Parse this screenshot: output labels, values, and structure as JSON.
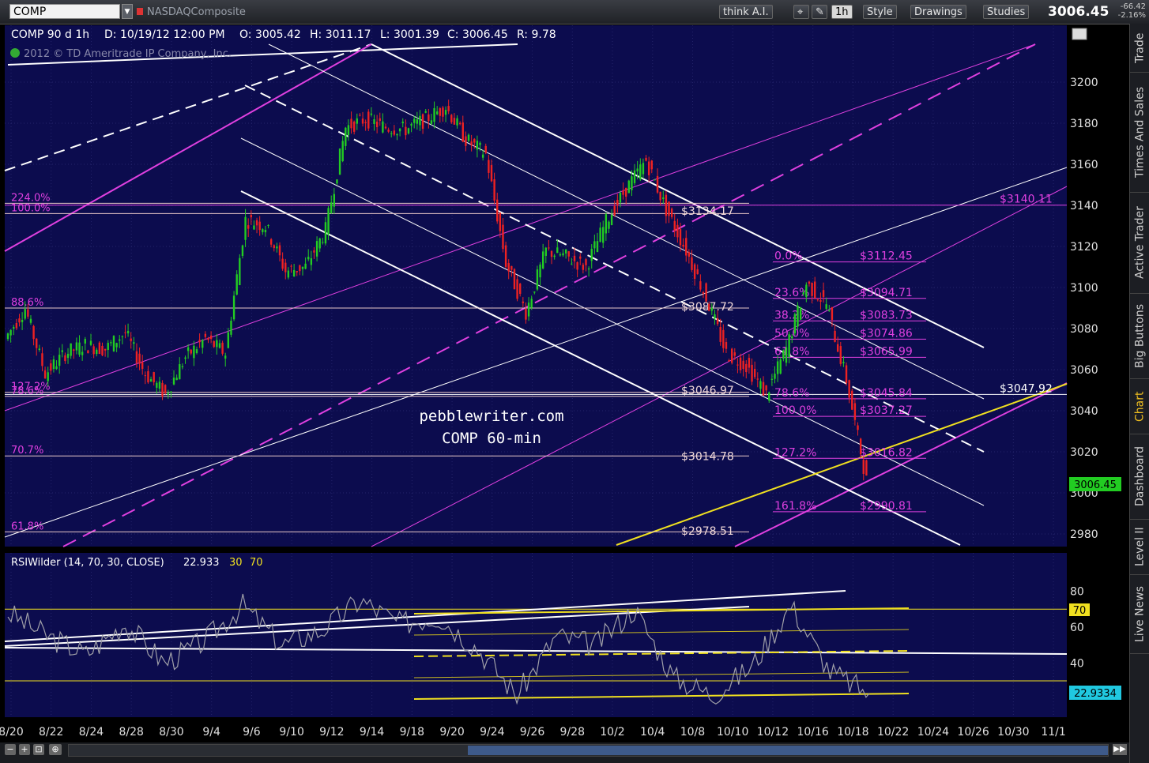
{
  "toolbar": {
    "symbol": "COMP",
    "symbol_name": "NASDAQComposite",
    "buttons": [
      "think A.I.",
      "1h",
      "Style",
      "Drawings",
      "Studies"
    ],
    "last": "3006.45",
    "change": "-66.42",
    "change_pct": "-2.16%"
  },
  "sidebar_tabs": [
    "Trade",
    "Times And Sales",
    "Active Trader",
    "Big Buttons",
    "Chart",
    "Dashboard",
    "Level II",
    "Live News"
  ],
  "header": {
    "period": "COMP 90 d 1h",
    "date": "D: 10/19/12 12:00 PM",
    "open": "O: 3005.42",
    "high": "H: 3011.17",
    "low": "L: 3001.39",
    "close": "C: 3006.45",
    "range": "R: 9.78",
    "copyright": "2012 © TD Ameritrade IP Company, Inc."
  },
  "watermark": {
    "line1": "pebblewriter.com",
    "line2": "COMP 60-min"
  },
  "colors": {
    "bg": "#0c0c4e",
    "magenta": "#e040e0",
    "white": "#ffffff",
    "yellow": "#f0e020",
    "up": "#22cc22",
    "down": "#ee2222",
    "rsi": "#a0a0a8"
  },
  "chart_data": [
    {
      "type": "line",
      "title": "",
      "xlabel": "",
      "ylabel": "",
      "y_ticks": [
        2980,
        3000,
        3020,
        3040,
        3060,
        3080,
        3100,
        3120,
        3140,
        3160,
        3180,
        3200
      ],
      "x_ticks": [
        "8/20",
        "8/22",
        "8/24",
        "8/28",
        "8/30",
        "9/4",
        "9/6",
        "9/10",
        "9/12",
        "9/14",
        "9/18",
        "9/20",
        "9/24",
        "9/26",
        "9/28",
        "10/2",
        "10/4",
        "10/8",
        "10/10",
        "10/12",
        "10/16",
        "10/18",
        "10/22",
        "10/24",
        "10/26",
        "10/30",
        "11/1"
      ],
      "ylim": [
        2976,
        3222
      ],
      "last_price_label": "3006.45",
      "series": [
        {
          "x": [
            "8/20",
            "8/21",
            "8/22",
            "8/23",
            "8/24",
            "8/27",
            "8/28",
            "8/29",
            "8/30",
            "8/31",
            "9/4",
            "9/5",
            "9/6",
            "9/7",
            "9/10",
            "9/11",
            "9/12",
            "9/13",
            "9/14",
            "9/17",
            "9/18",
            "9/19",
            "9/20",
            "9/21",
            "9/24",
            "9/25",
            "9/26",
            "9/27",
            "9/28",
            "10/1",
            "10/2",
            "10/3",
            "10/4",
            "10/5",
            "10/8",
            "10/9",
            "10/10",
            "10/11",
            "10/12",
            "10/15",
            "10/16",
            "10/17",
            "10/18",
            "10/19"
          ],
          "values": [
            3075,
            3090,
            3058,
            3068,
            3072,
            3070,
            3078,
            3058,
            3048,
            3066,
            3075,
            3068,
            3133,
            3130,
            3108,
            3110,
            3128,
            3178,
            3182,
            3178,
            3177,
            3182,
            3188,
            3172,
            3165,
            3112,
            3088,
            3118,
            3115,
            3110,
            3132,
            3148,
            3162,
            3138,
            3118,
            3095,
            3068,
            3062,
            3048,
            3070,
            3102,
            3092,
            3055,
            3006
          ]
        }
      ],
      "horizontal_levels": [
        {
          "label": "$3134.17",
          "value": 3134.17
        },
        {
          "label": "$3087.72",
          "value": 3087.72
        },
        {
          "label": "$3046.97",
          "value": 3046.97
        },
        {
          "label": "$3014.78",
          "value": 3014.78
        },
        {
          "label": "$2978.51",
          "value": 2978.51
        }
      ],
      "fib_left": [
        {
          "label": "224.0%",
          "value": 3141
        },
        {
          "label": "100.0%",
          "value": 3136
        },
        {
          "label": "88.6%",
          "value": 3090
        },
        {
          "label": "127.2%",
          "value": 3049
        },
        {
          "label": "78.6%",
          "value": 3047
        },
        {
          "label": "70.7%",
          "value": 3018
        },
        {
          "label": "61.8%",
          "value": 2981
        }
      ],
      "fib_right": [
        {
          "pct": "0.0%",
          "label": "$3112.45",
          "value": 3112.45
        },
        {
          "pct": "23.6%",
          "label": "$3094.71",
          "value": 3094.71
        },
        {
          "pct": "38.2%",
          "label": "$3083.73",
          "value": 3083.73
        },
        {
          "pct": "50.0%",
          "label": "$3074.86",
          "value": 3074.86
        },
        {
          "pct": "61.8%",
          "label": "$3065.99",
          "value": 3065.99
        },
        {
          "pct": "78.6%",
          "label": "$3045.84",
          "value": 3045.84
        },
        {
          "pct": "100.0%",
          "label": "$3037.27",
          "value": 3037.27
        },
        {
          "pct": "127.2%",
          "label": "$3016.82",
          "value": 3016.82
        },
        {
          "pct": "161.8%",
          "label": "$2990.81",
          "value": 2990.81
        }
      ],
      "right_labels": [
        {
          "label": "$3140.11",
          "value": 3140.11
        },
        {
          "label": "$3047.92",
          "value": 3047.92
        }
      ]
    },
    {
      "type": "line",
      "title": "RSIWilder (14, 70, 30, CLOSE)",
      "header_values": [
        "22.933",
        "30",
        "70"
      ],
      "y_ticks": [
        40,
        60,
        80
      ],
      "ylim": [
        10,
        90
      ],
      "last_value_label": "22.9334",
      "overbought_label": "70",
      "series": [
        {
          "x": [
            "8/20",
            "8/22",
            "8/24",
            "8/28",
            "8/30",
            "9/4",
            "9/6",
            "9/10",
            "9/12",
            "9/14",
            "9/18",
            "9/20",
            "9/24",
            "9/26",
            "9/28",
            "10/2",
            "10/4",
            "10/8",
            "10/10",
            "10/12",
            "10/16",
            "10/18",
            "10/19"
          ],
          "values": [
            68,
            55,
            45,
            62,
            40,
            52,
            72,
            50,
            58,
            75,
            62,
            66,
            48,
            22,
            55,
            50,
            70,
            32,
            22,
            38,
            72,
            35,
            23
          ]
        }
      ]
    }
  ]
}
